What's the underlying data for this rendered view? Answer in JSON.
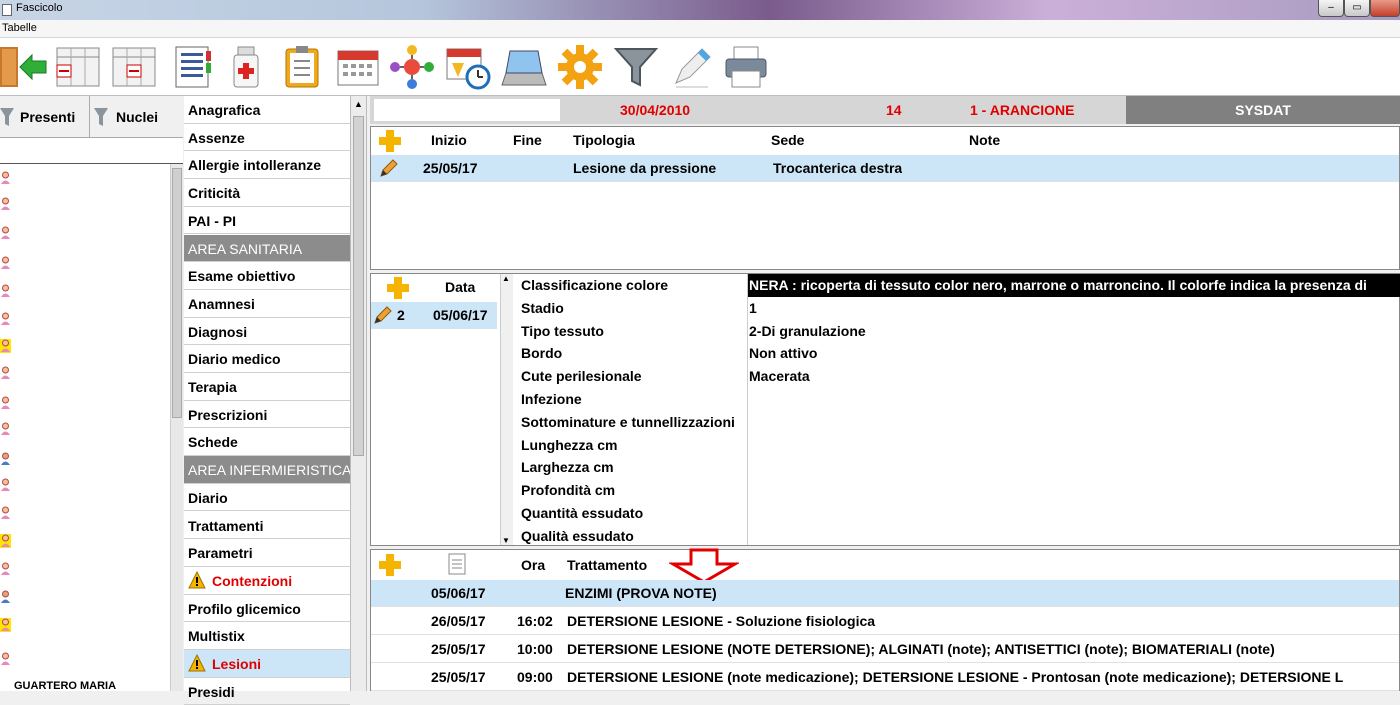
{
  "window": {
    "title": "Fascicolo",
    "menu": [
      "Tabelle"
    ]
  },
  "left_panel": {
    "tab_presenti": "Presenti",
    "tab_nuclei": "Nuclei",
    "partial_name": "GUARTERO MARIA"
  },
  "nav": {
    "items": [
      {
        "label": "Anagrafica",
        "type": "item"
      },
      {
        "label": "Assenze",
        "type": "item"
      },
      {
        "label": "Allergie intolleranze",
        "type": "item"
      },
      {
        "label": "Criticità",
        "type": "item"
      },
      {
        "label": "PAI - PI",
        "type": "item"
      },
      {
        "label": "AREA SANITARIA",
        "type": "section"
      },
      {
        "label": "Esame obiettivo",
        "type": "item"
      },
      {
        "label": "Anamnesi",
        "type": "item"
      },
      {
        "label": "Diagnosi",
        "type": "item"
      },
      {
        "label": "Diario medico",
        "type": "item"
      },
      {
        "label": "Terapia",
        "type": "item"
      },
      {
        "label": "Prescrizioni",
        "type": "item"
      },
      {
        "label": "Schede",
        "type": "item"
      },
      {
        "label": "AREA INFERMIERISTICA",
        "type": "section"
      },
      {
        "label": "Diario",
        "type": "item"
      },
      {
        "label": "Trattamenti",
        "type": "item"
      },
      {
        "label": "Parametri",
        "type": "item"
      },
      {
        "label": "Contenzioni",
        "type": "warning"
      },
      {
        "label": "Profilo glicemico",
        "type": "item"
      },
      {
        "label": "Multistix",
        "type": "item"
      },
      {
        "label": "Lesioni",
        "type": "warning-active"
      },
      {
        "label": "Presidi",
        "type": "item"
      }
    ]
  },
  "header": {
    "date": "30/04/2010",
    "number": "14",
    "code": "1 - ARANCIONE",
    "org": "SYSDAT"
  },
  "lesions": {
    "columns": [
      "Inizio",
      "Fine",
      "Tipologia",
      "Sede",
      "Note"
    ],
    "rows": [
      {
        "inizio": "25/05/17",
        "fine": "",
        "tipologia": "Lesione da pressione",
        "sede": "Trocanterica destra",
        "note": ""
      }
    ]
  },
  "evaluations": {
    "column": "Data",
    "rows": [
      {
        "num": "2",
        "data": "05/06/17"
      }
    ]
  },
  "details": [
    {
      "label": "Classificazione colore",
      "value": "NERA : ricoperta di tessuto color nero, marrone o marroncino. Il colorfe indica la presenza di"
    },
    {
      "label": "Stadio",
      "value": "1"
    },
    {
      "label": "Tipo tessuto",
      "value": "2-Di granulazione"
    },
    {
      "label": "Bordo",
      "value": "Non attivo"
    },
    {
      "label": "Cute perilesionale",
      "value": "Macerata"
    },
    {
      "label": "Infezione",
      "value": ""
    },
    {
      "label": "Sottominature e tunnellizzazioni",
      "value": ""
    },
    {
      "label": "Lunghezza cm",
      "value": ""
    },
    {
      "label": "Larghezza cm",
      "value": ""
    },
    {
      "label": "Profondità cm",
      "value": ""
    },
    {
      "label": "Quantità essudato",
      "value": ""
    },
    {
      "label": "Qualità essudato",
      "value": ""
    }
  ],
  "treatments": {
    "columns": [
      "Ora",
      "Trattamento"
    ],
    "rows": [
      {
        "date": "05/06/17",
        "ora": "",
        "trattamento": "ENZIMI (PROVA NOTE)"
      },
      {
        "date": "26/05/17",
        "ora": "16:02",
        "trattamento": "DETERSIONE LESIONE - Soluzione fisiologica"
      },
      {
        "date": "25/05/17",
        "ora": "10:00",
        "trattamento": "DETERSIONE LESIONE (NOTE DETERSIONE); ALGINATI (note); ANTISETTICI (note); BIOMATERIALI (note)"
      },
      {
        "date": "25/05/17",
        "ora": "09:00",
        "trattamento": "DETERSIONE LESIONE (note medicazione);  DETERSIONE LESIONE - Prontosan (note medicazione);  DETERSIONE L"
      }
    ]
  },
  "icons": {
    "toolbar": [
      "exit-icon",
      "grid-remove-icon",
      "grid-remove-icon",
      "list-icon",
      "medicine-bottle-icon",
      "clipboard-icon",
      "calendar-icon",
      "network-icon",
      "calendar-clock-icon",
      "scanner-icon",
      "gear-icon",
      "filter-icon",
      "pen-icon",
      "printer-icon"
    ]
  },
  "colors": {
    "accent_red": "#e00000",
    "selection": "#cce5f7",
    "section": "#8c8c8c",
    "highlight_arrow": "#e00000"
  }
}
